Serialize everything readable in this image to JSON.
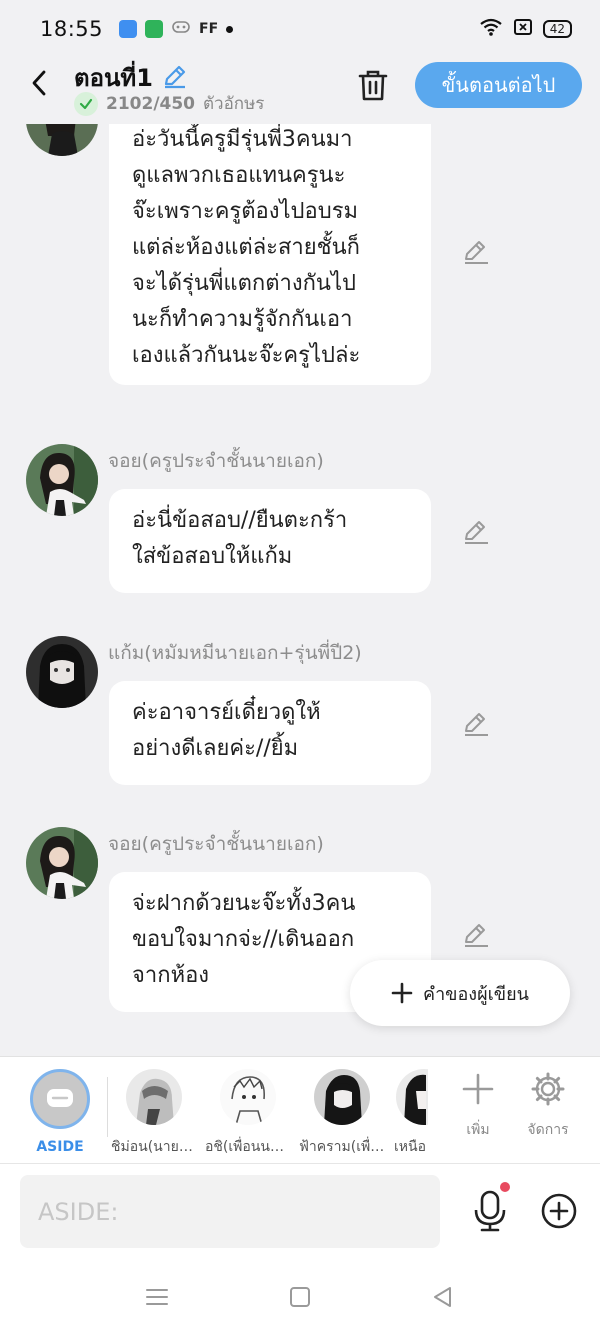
{
  "status": {
    "time": "18:55",
    "battery": "42",
    "notification_app": "FF"
  },
  "header": {
    "title": "ตอนที่1",
    "char_count": "2102/450",
    "char_unit": "ตัวอักษร",
    "next_label": "ขั้นตอนต่อไป"
  },
  "messages": [
    {
      "speaker": "",
      "text": "อ่ะวันนี้ครูมีรุ่นพี่3คนมา\nดูแลพวกเธอแทนครูนะ\nจ๊ะเพราะครูต้องไปอบรม\nแต่ล่ะห้องแต่ล่ะสายชั้นก็\nจะได้รุ่นพี่แตกต่างกันไป\nนะก็ทำความรู้จักกันเอา\nเองแล้วกันนะจ๊ะครูไปล่ะ"
    },
    {
      "speaker": "จอย(ครูประจำชั้นนายเอก)",
      "text": "อ่ะนี่ข้อสอบ//ยืนตะกร้า\nใส่ข้อสอบให้แก้ม"
    },
    {
      "speaker": "แก้ม(หมัมหมีนายเอก+รุ่นพี่ปี2)",
      "text": "ค่ะอาจารย์เดี๋ยวดูให้\nอย่างดีเลยค่ะ//ยิ้ม"
    },
    {
      "speaker": "จอย(ครูประจำชั้นนายเอก)",
      "text": "จ่ะฝากด้วยนะจ๊ะทั้ง3คน\nขอบใจมากจ่ะ//เดินออก\nจากห้อง"
    }
  ],
  "fab_label": "คำของผู้เขียน",
  "characters": {
    "aside": "ASIDE",
    "list": [
      "ชิม่อน(นายเอก",
      "อชิ(เพื่อนนายเอก",
      "ฟ้าคราม(เพื่อน",
      "เหนือ"
    ],
    "add_label": "เพิ่ม",
    "manage_label": "จัดการ"
  },
  "input": {
    "placeholder": "ASIDE:"
  },
  "colors": {
    "accent": "#5aa8ee",
    "aside_accent": "#3b8ee8",
    "record_dot": "#e84a5f"
  }
}
